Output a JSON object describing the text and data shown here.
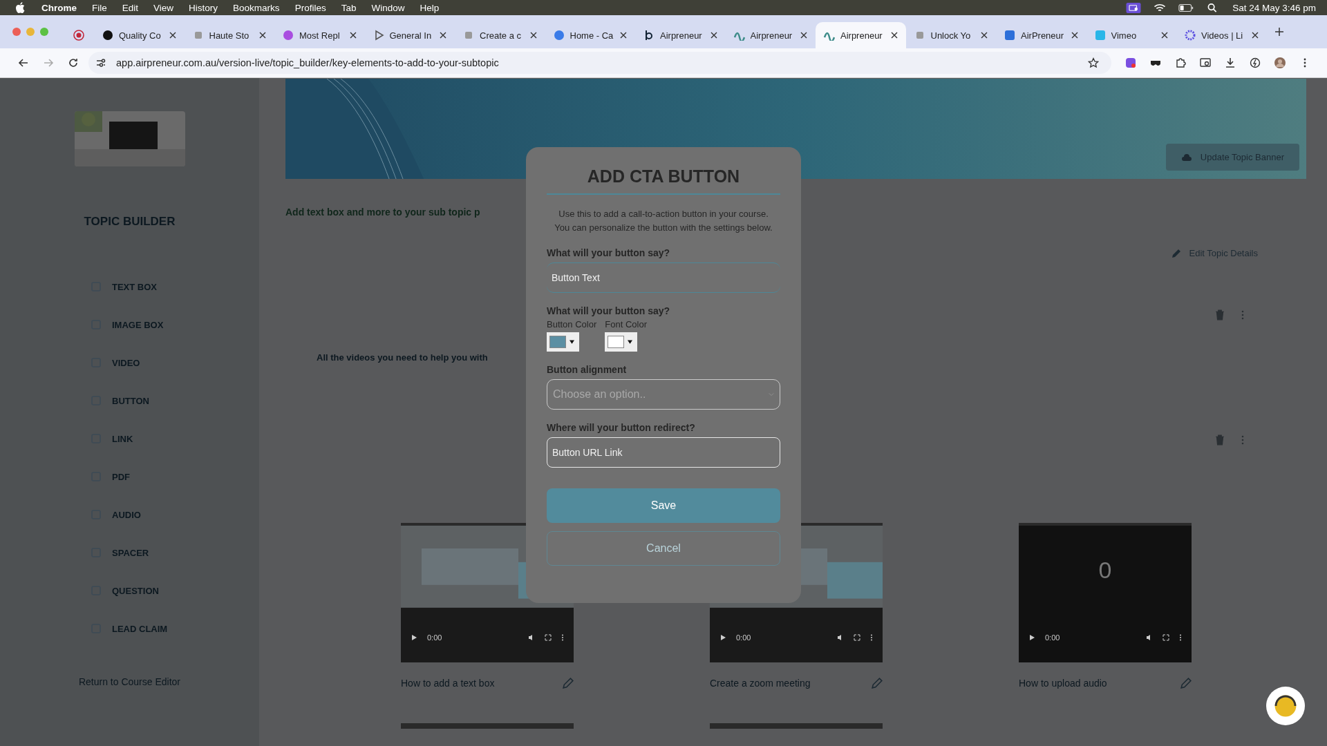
{
  "menu_bar": {
    "app": "Chrome",
    "items": [
      "File",
      "Edit",
      "View",
      "History",
      "Bookmarks",
      "Profiles",
      "Tab",
      "Window",
      "Help"
    ],
    "clock": "Sat 24 May  3:46 pm"
  },
  "tabs": [
    {
      "selected": false,
      "kind": "record"
    },
    {
      "title": "Quality Co",
      "selected": false,
      "kind": "dark"
    },
    {
      "title": "Haute Sto",
      "selected": false,
      "kind": "mark"
    },
    {
      "title": "Most Repl",
      "selected": false,
      "kind": "podcast"
    },
    {
      "title": "General In",
      "selected": false,
      "kind": "play"
    },
    {
      "title": "Create a c",
      "selected": false,
      "kind": "mark"
    },
    {
      "title": "Home - Ca",
      "selected": false,
      "kind": "circle"
    },
    {
      "title": "Airpreneur",
      "selected": false,
      "kind": "letter"
    },
    {
      "title": "Airpreneur",
      "selected": false,
      "kind": "wave"
    },
    {
      "title": "Airpreneur",
      "selected": true,
      "kind": "wave"
    },
    {
      "title": "Unlock Yo",
      "selected": false,
      "kind": "mark"
    },
    {
      "title": "AirPreneur",
      "selected": false,
      "kind": "square"
    },
    {
      "title": "Vimeo",
      "selected": false,
      "kind": "vimeo"
    },
    {
      "title": "Videos | Li",
      "selected": false,
      "kind": "star"
    }
  ],
  "address_bar": {
    "url": "app.airpreneur.com.au/version-live/topic_builder/key-elements-to-add-to-your-subtopic"
  },
  "sidebar": {
    "title": "TOPIC BUILDER",
    "items": [
      {
        "label": "TEXT BOX"
      },
      {
        "label": "IMAGE BOX"
      },
      {
        "label": "VIDEO"
      },
      {
        "label": "BUTTON"
      },
      {
        "label": "LINK"
      },
      {
        "label": "PDF"
      },
      {
        "label": "AUDIO"
      },
      {
        "label": "SPACER"
      },
      {
        "label": "QUESTION"
      },
      {
        "label": "LEAD CLAIM"
      }
    ],
    "footer_link": "Return to Course Editor"
  },
  "banner": {
    "button": "Update Topic Banner"
  },
  "intro": "Add text box and more to your sub topic p",
  "edit_details": "Edit Topic Details",
  "videos_heading": "All the videos you need to help you with",
  "videos": [
    {
      "title": "How to add a text box",
      "time": "0:00",
      "kind": "picture"
    },
    {
      "title": "Create a zoom meeting",
      "time": "0:00",
      "kind": "picture"
    },
    {
      "title": "How to upload audio",
      "time": "0:00",
      "kind": "black",
      "counter": "0"
    }
  ],
  "modal": {
    "title": "ADD CTA BUTTON",
    "description": "Use this to add a call-to-action button in your course. You can personalize the button with the settings below.",
    "text_label": "What will your button say?",
    "text_field": {
      "placeholder": "Button Text"
    },
    "color_label": "What will your button say?",
    "color_pickers": [
      {
        "label": "Button Color",
        "color": "#5b8fa3"
      },
      {
        "label": "Font Color",
        "color": "#ffffff"
      }
    ],
    "alignment_label": "Button alignment",
    "alignment_select": {
      "placeholder": "Choose an option.."
    },
    "url_label": "Where will your button redirect?",
    "url_field": {
      "placeholder": "Button URL Link"
    },
    "buttons": [
      {
        "label": "Save",
        "kind": "primary"
      },
      {
        "label": "Cancel",
        "kind": "secondary"
      }
    ]
  }
}
